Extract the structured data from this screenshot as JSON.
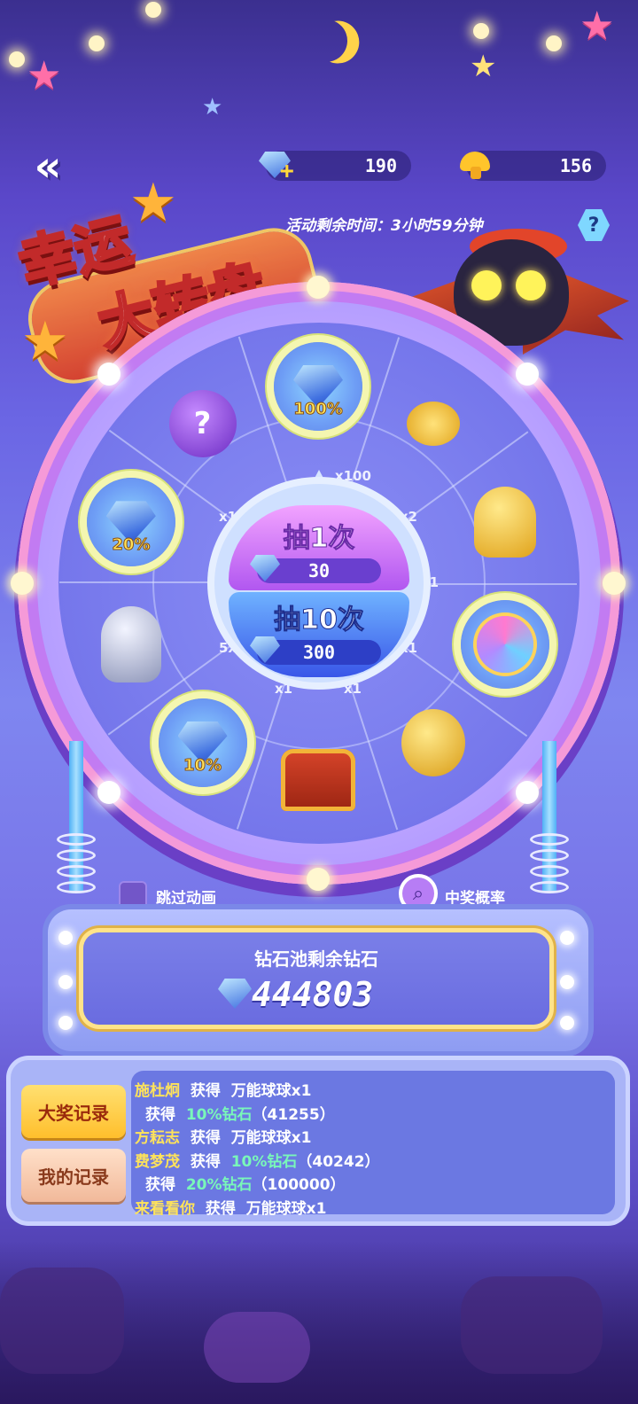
{
  "currency": {
    "diamonds": "190",
    "mushrooms": "156"
  },
  "timer": {
    "label": "活动剩余时间：3小时59分钟"
  },
  "help_label": "?",
  "title": {
    "line1": "幸运",
    "line2": "大转盘"
  },
  "wheel": {
    "prizes": [
      {
        "name": "diamond-pile",
        "label": "100%",
        "multiplier": "x100"
      },
      {
        "name": "gold-coins",
        "label": "",
        "multiplier": "x2"
      },
      {
        "name": "golden-mushrooms",
        "label": "",
        "multiplier": "x1"
      },
      {
        "name": "universal-ball",
        "label": "",
        "multiplier": "x1"
      },
      {
        "name": "golden-egg",
        "label": "",
        "multiplier": "x1"
      },
      {
        "name": "treasure-chest",
        "label": "",
        "multiplier": "x1"
      },
      {
        "name": "diamond-pile-10",
        "label": "10%",
        "multiplier": "5x"
      },
      {
        "name": "silver-mushrooms",
        "label": "",
        "multiplier": ""
      },
      {
        "name": "diamond-pile-20",
        "label": "20%",
        "multiplier": "x1"
      },
      {
        "name": "mystery-ball",
        "label": "?",
        "multiplier": ""
      }
    ]
  },
  "spin": {
    "once_label": "抽1次",
    "once_cost": "30",
    "ten_label": "抽10次",
    "ten_cost": "300"
  },
  "options": {
    "skip_label": "跳过动画",
    "odds_label": "中奖概率"
  },
  "pool": {
    "title": "钻石池剩余钻石",
    "value": "444803"
  },
  "records": {
    "tab_grand": "大奖记录",
    "tab_mine": "我的记录",
    "rows": [
      {
        "name": "施杜炯",
        "verb": "获得",
        "item": "万能球球x1",
        "extra": "",
        "green": false
      },
      {
        "name": "",
        "verb": "获得",
        "item": "10%钻石",
        "extra": "（41255）",
        "green": true
      },
      {
        "name": "方耘志",
        "verb": "获得",
        "item": "万能球球x1",
        "extra": "",
        "green": false
      },
      {
        "name": "费梦茂",
        "verb": "获得",
        "item": "10%钻石",
        "extra": "（40242）",
        "green": true
      },
      {
        "name": "",
        "verb": "获得",
        "item": "20%钻石",
        "extra": "（100000）",
        "green": true
      },
      {
        "name": "来看看你",
        "verb": "获得",
        "item": "万能球球x1",
        "extra": "",
        "green": false
      }
    ]
  },
  "colors": {
    "accent_yellow": "#ffe35a",
    "accent_green": "#79f7b9",
    "background_top": "#3b2f8f",
    "background_mid": "#7f86f0"
  }
}
